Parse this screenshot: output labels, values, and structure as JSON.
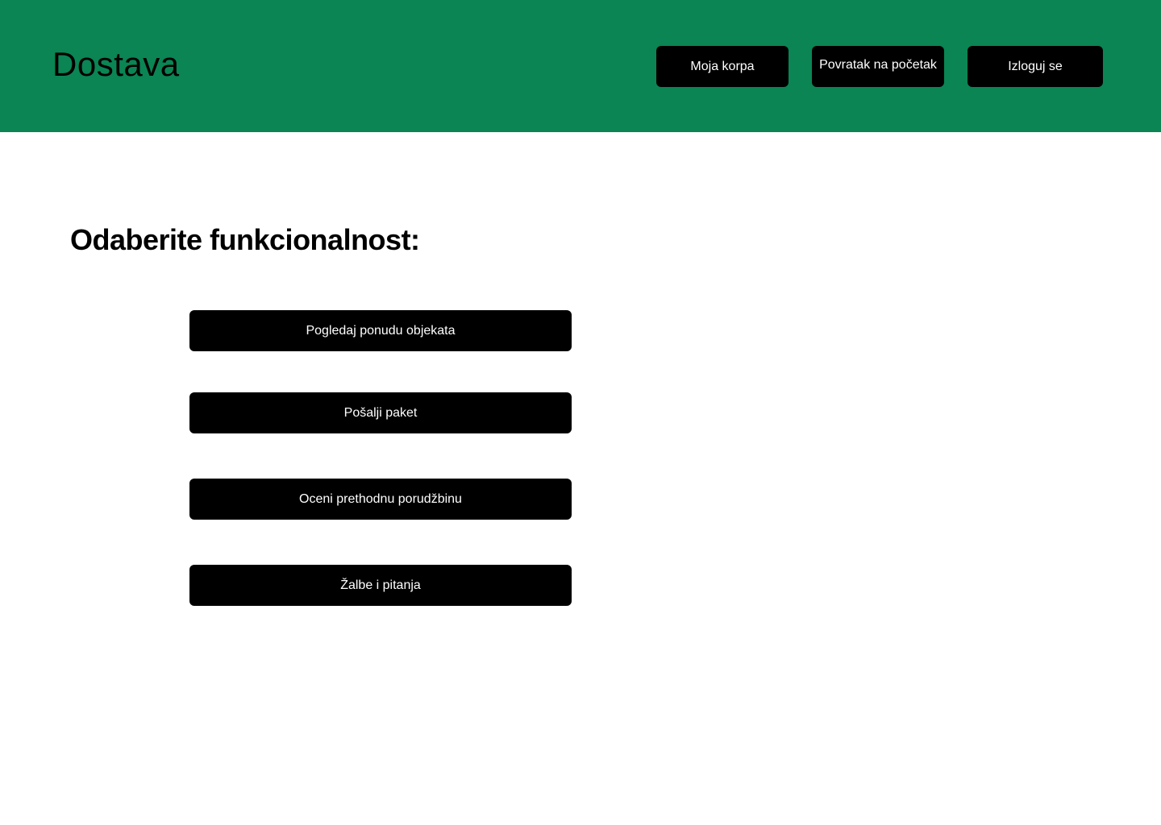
{
  "header": {
    "brand": "Dostava",
    "nav": {
      "cart_label": "Moja korpa",
      "home_label": "Povratak na početak",
      "logout_label": "Izloguj se"
    },
    "background_color": "#0a8553"
  },
  "main": {
    "heading": "Odaberite funkcionalnost:",
    "actions": [
      {
        "label": "Pogledaj ponudu objekata"
      },
      {
        "label": "Pošalji paket"
      },
      {
        "label": "Oceni prethodnu porudžbinu"
      },
      {
        "label": "Žalbe i pitanja"
      }
    ]
  }
}
